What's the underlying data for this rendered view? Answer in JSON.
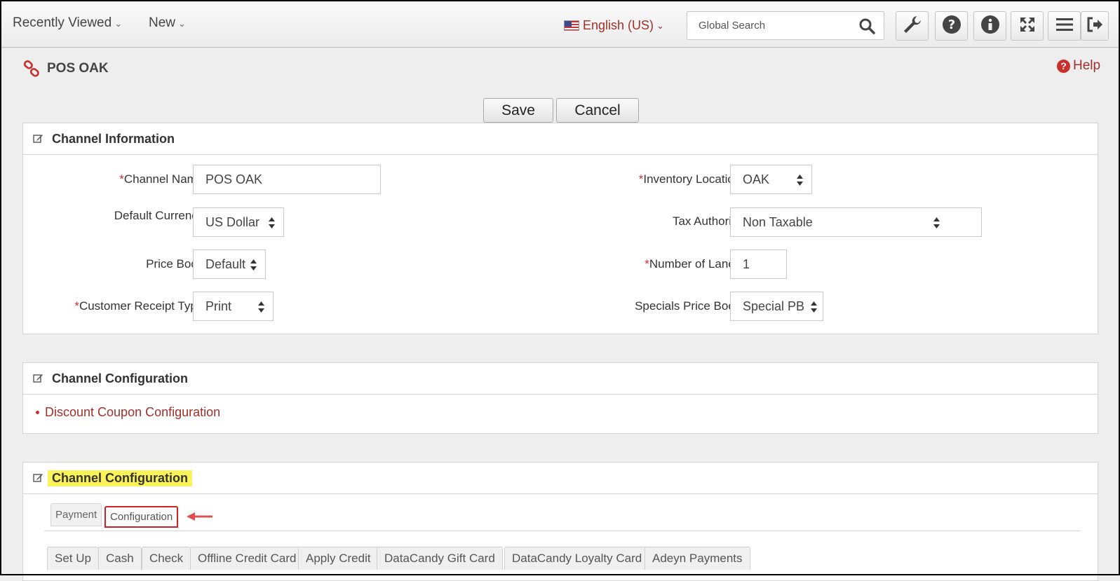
{
  "topbar": {
    "recently_viewed": "Recently Viewed",
    "new": "New",
    "language": "English (US)",
    "search_placeholder": "Global Search"
  },
  "page": {
    "title": "POS OAK",
    "help": "Help",
    "save": "Save",
    "cancel": "Cancel"
  },
  "channel_info": {
    "title": "Channel Information",
    "channel_name_label": "Channel Name:",
    "channel_name_value": "POS OAK",
    "default_currency_label": "Default Currency:",
    "default_currency_value": "US Dollar",
    "price_book_label": "Price Book:",
    "price_book_value": "Default",
    "receipt_type_label": "Customer Receipt Type:",
    "receipt_type_value": "Print",
    "inventory_location_label": "Inventory Location:",
    "inventory_location_value": "OAK",
    "tax_authority_label": "Tax Authority:",
    "tax_authority_value": "Non Taxable",
    "lanes_label": "Number of Lanes:",
    "lanes_value": "1",
    "specials_label": "Specials Price Book:",
    "specials_value": "Special PB",
    "required_mark": "*"
  },
  "channel_config_1": {
    "title": "Channel Configuration",
    "link": "Discount Coupon Configuration"
  },
  "channel_config_2": {
    "title": "Channel Configuration",
    "tabs": [
      "Payment",
      "Configuration"
    ],
    "subtabs": [
      "Set Up",
      "Cash",
      "Check",
      "Offline Credit Card",
      "Apply Credit",
      "DataCandy Gift Card",
      "DataCandy Loyalty Card",
      "Adeyn Payments"
    ]
  },
  "colors": {
    "accent_red": "#a0302a",
    "highlight_yellow": "#fbf35a",
    "annotation_red": "#d0202a"
  }
}
